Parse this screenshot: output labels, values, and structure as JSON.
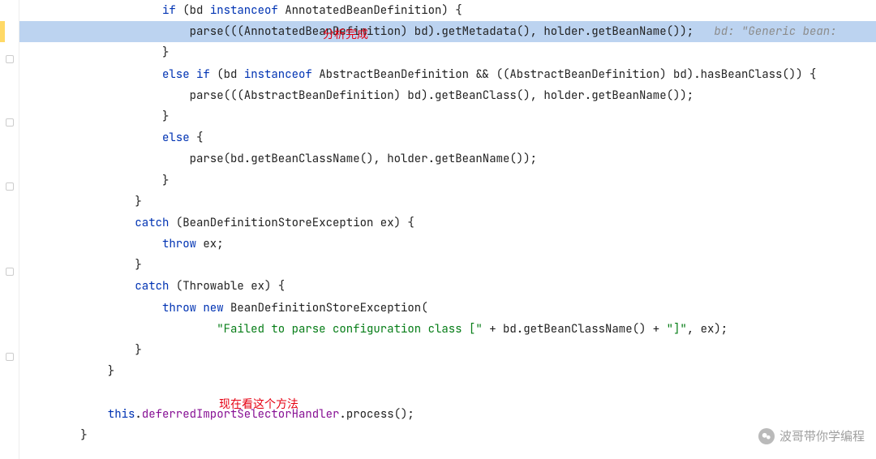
{
  "code": {
    "lines": [
      {
        "indent": 20,
        "tokens": [
          {
            "t": "kw",
            "v": "if"
          },
          {
            "t": "plain",
            "v": " (bd "
          },
          {
            "t": "kw",
            "v": "instanceof"
          },
          {
            "t": "plain",
            "v": " AnnotatedBeanDefinition) {"
          }
        ]
      },
      {
        "indent": 24,
        "highlight": true,
        "tokens": [
          {
            "t": "plain",
            "v": "parse(((AnnotatedBeanDefinition) bd).getMetadata(), holder.getBeanName());   "
          },
          {
            "t": "comment",
            "v": "bd: \"Generic bean:"
          }
        ]
      },
      {
        "indent": 20,
        "tokens": [
          {
            "t": "plain",
            "v": "}"
          }
        ]
      },
      {
        "indent": 20,
        "tokens": [
          {
            "t": "kw",
            "v": "else if"
          },
          {
            "t": "plain",
            "v": " (bd "
          },
          {
            "t": "kw",
            "v": "instanceof"
          },
          {
            "t": "plain",
            "v": " AbstractBeanDefinition && ((AbstractBeanDefinition) bd).hasBeanClass()) {"
          }
        ]
      },
      {
        "indent": 24,
        "tokens": [
          {
            "t": "plain",
            "v": "parse(((AbstractBeanDefinition) bd).getBeanClass(), holder.getBeanName());"
          }
        ]
      },
      {
        "indent": 20,
        "tokens": [
          {
            "t": "plain",
            "v": "}"
          }
        ]
      },
      {
        "indent": 20,
        "tokens": [
          {
            "t": "kw",
            "v": "else"
          },
          {
            "t": "plain",
            "v": " {"
          }
        ]
      },
      {
        "indent": 24,
        "tokens": [
          {
            "t": "plain",
            "v": "parse(bd.getBeanClassName(), holder.getBeanName());"
          }
        ]
      },
      {
        "indent": 20,
        "tokens": [
          {
            "t": "plain",
            "v": "}"
          }
        ]
      },
      {
        "indent": 16,
        "tokens": [
          {
            "t": "plain",
            "v": "}"
          }
        ]
      },
      {
        "indent": 16,
        "tokens": [
          {
            "t": "kw",
            "v": "catch"
          },
          {
            "t": "plain",
            "v": " (BeanDefinitionStoreException ex) {"
          }
        ]
      },
      {
        "indent": 20,
        "tokens": [
          {
            "t": "kw",
            "v": "throw"
          },
          {
            "t": "plain",
            "v": " ex;"
          }
        ]
      },
      {
        "indent": 16,
        "tokens": [
          {
            "t": "plain",
            "v": "}"
          }
        ]
      },
      {
        "indent": 16,
        "tokens": [
          {
            "t": "kw",
            "v": "catch"
          },
          {
            "t": "plain",
            "v": " (Throwable ex) {"
          }
        ]
      },
      {
        "indent": 20,
        "tokens": [
          {
            "t": "kw",
            "v": "throw new"
          },
          {
            "t": "plain",
            "v": " BeanDefinitionStoreException("
          }
        ]
      },
      {
        "indent": 28,
        "tokens": [
          {
            "t": "str",
            "v": "\"Failed to parse configuration class [\""
          },
          {
            "t": "plain",
            "v": " + bd.getBeanClassName() + "
          },
          {
            "t": "str",
            "v": "\"]\""
          },
          {
            "t": "plain",
            "v": ", ex);"
          }
        ]
      },
      {
        "indent": 16,
        "tokens": [
          {
            "t": "plain",
            "v": "}"
          }
        ]
      },
      {
        "indent": 12,
        "tokens": [
          {
            "t": "plain",
            "v": "}"
          }
        ]
      },
      {
        "indent": 0,
        "tokens": []
      },
      {
        "indent": 12,
        "tokens": [
          {
            "t": "kw",
            "v": "this"
          },
          {
            "t": "plain",
            "v": "."
          },
          {
            "t": "field",
            "v": "deferredImportSelectorHandler"
          },
          {
            "t": "plain",
            "v": ".process();"
          }
        ]
      },
      {
        "indent": 8,
        "tokens": [
          {
            "t": "plain",
            "v": "}"
          }
        ]
      }
    ]
  },
  "annotations": {
    "label1": "分析完成",
    "label2": "现在看这个方法"
  },
  "watermark": {
    "text": "波哥带你学编程"
  }
}
